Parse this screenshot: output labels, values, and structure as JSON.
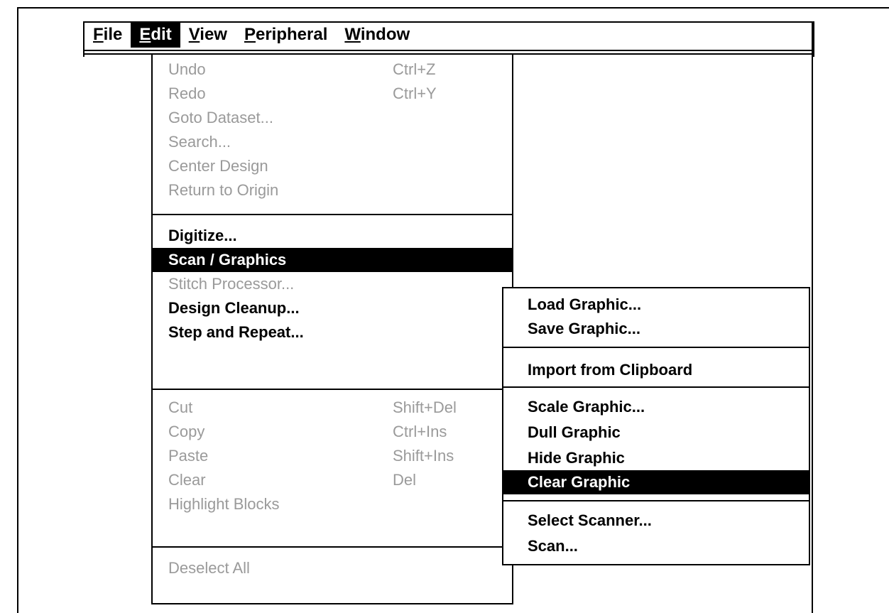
{
  "menubar": {
    "items": [
      {
        "label": "File",
        "key": "F"
      },
      {
        "label": "Edit",
        "key": "E"
      },
      {
        "label": "View",
        "key": "V"
      },
      {
        "label": "Peripheral",
        "key": "P"
      },
      {
        "label": "Window",
        "key": "W"
      }
    ]
  },
  "edit_menu": {
    "group1": [
      {
        "label": "Undo",
        "shortcut": "Ctrl+Z"
      },
      {
        "label": "Redo",
        "shortcut": "Ctrl+Y"
      },
      {
        "label": "Goto Dataset...",
        "shortcut": ""
      },
      {
        "label": "Search...",
        "shortcut": ""
      },
      {
        "label": "Center Design",
        "shortcut": ""
      },
      {
        "label": "Return to Origin",
        "shortcut": ""
      }
    ],
    "group2": [
      {
        "label": "Digitize..."
      },
      {
        "label": "Scan / Graphics"
      },
      {
        "label": "Stitch Processor..."
      },
      {
        "label": "Design Cleanup..."
      },
      {
        "label": "Step and Repeat..."
      }
    ],
    "group3": [
      {
        "label": "Cut",
        "shortcut": "Shift+Del"
      },
      {
        "label": "Copy",
        "shortcut": "Ctrl+Ins"
      },
      {
        "label": "Paste",
        "shortcut": "Shift+Ins"
      },
      {
        "label": "Clear",
        "shortcut": "Del"
      },
      {
        "label": "Highlight Blocks",
        "shortcut": ""
      }
    ],
    "group4": [
      {
        "label": "Deselect All"
      }
    ]
  },
  "scan_submenu": {
    "group1": [
      {
        "label": "Load Graphic..."
      },
      {
        "label": "Save Graphic..."
      }
    ],
    "group2": [
      {
        "label": "Import from Clipboard"
      }
    ],
    "group3": [
      {
        "label": "Scale Graphic..."
      },
      {
        "label": "Dull Graphic"
      },
      {
        "label": "Hide Graphic"
      },
      {
        "label": "Clear Graphic"
      }
    ],
    "group4": [
      {
        "label": "Select Scanner..."
      },
      {
        "label": "Scan..."
      }
    ]
  }
}
